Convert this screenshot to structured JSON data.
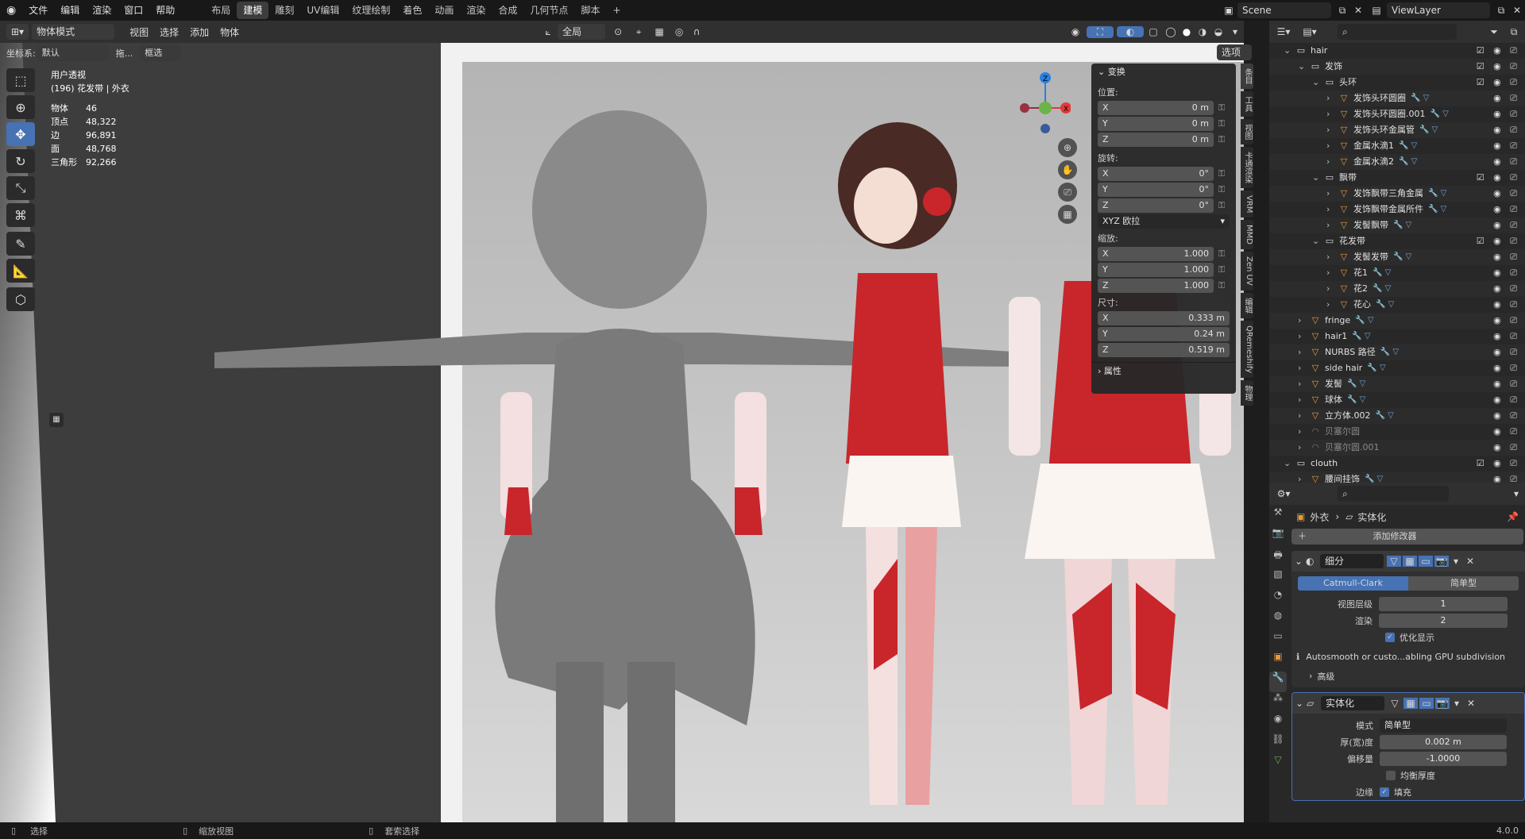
{
  "topbar": {
    "menus": [
      "文件",
      "编辑",
      "渲染",
      "窗口",
      "帮助"
    ],
    "workspaces": [
      "布局",
      "建模",
      "雕刻",
      "UV编辑",
      "纹理绘制",
      "着色",
      "动画",
      "渲染",
      "合成",
      "几何节点",
      "脚本"
    ],
    "active_workspace": "建模",
    "add_tab": "+",
    "scene": "Scene",
    "viewlayer": "ViewLayer"
  },
  "viewport_header": {
    "mode": "物体模式",
    "menus": [
      "视图",
      "选择",
      "添加",
      "物体"
    ],
    "transform_orientation": "全局",
    "options": "选项",
    "coord_label": "坐标系:",
    "coord_value": "默认",
    "drag_label": "拖...",
    "select_mode": "框选"
  },
  "stats": {
    "view": "用户透视",
    "object": "(196) 花发带 | 外衣",
    "rows": [
      {
        "k": "物体",
        "v": "46"
      },
      {
        "k": "顶点",
        "v": "48,322"
      },
      {
        "k": "边",
        "v": "96,891"
      },
      {
        "k": "面",
        "v": "48,768"
      },
      {
        "k": "三角形",
        "v": "92,266"
      }
    ]
  },
  "npanel": {
    "header": "变换",
    "location_label": "位置:",
    "location": [
      {
        "a": "X",
        "v": "0 m"
      },
      {
        "a": "Y",
        "v": "0 m"
      },
      {
        "a": "Z",
        "v": "0 m"
      }
    ],
    "rotation_label": "旋转:",
    "rotation": [
      {
        "a": "X",
        "v": "0°"
      },
      {
        "a": "Y",
        "v": "0°"
      },
      {
        "a": "Z",
        "v": "0°"
      }
    ],
    "rotation_mode": "XYZ 欧拉",
    "scale_label": "缩放:",
    "scale": [
      {
        "a": "X",
        "v": "1.000"
      },
      {
        "a": "Y",
        "v": "1.000"
      },
      {
        "a": "Z",
        "v": "1.000"
      }
    ],
    "dimensions_label": "尺寸:",
    "dimensions": [
      {
        "a": "X",
        "v": "0.333 m"
      },
      {
        "a": "Y",
        "v": "0.24 m"
      },
      {
        "a": "Z",
        "v": "0.519 m"
      }
    ],
    "properties": "属性",
    "tabs": [
      "条目",
      "工具",
      "视图",
      "卡通渲染",
      "VRM",
      "MMD",
      "Zen UV",
      "编辑",
      "QRemeshify",
      "物理"
    ]
  },
  "outliner": {
    "rows": [
      {
        "indent": 1,
        "label": "hair",
        "type": "coll"
      },
      {
        "indent": 2,
        "label": "发饰",
        "type": "coll"
      },
      {
        "indent": 3,
        "label": "头环",
        "type": "coll"
      },
      {
        "indent": 4,
        "label": "发饰头环圆圈",
        "type": "mesh"
      },
      {
        "indent": 4,
        "label": "发饰头环圆圈.001",
        "type": "mesh"
      },
      {
        "indent": 4,
        "label": "发饰头环金属管",
        "type": "mesh"
      },
      {
        "indent": 4,
        "label": "金属水滴1",
        "type": "mesh"
      },
      {
        "indent": 4,
        "label": "金属水滴2",
        "type": "mesh"
      },
      {
        "indent": 3,
        "label": "飘带",
        "type": "coll"
      },
      {
        "indent": 4,
        "label": "发饰飘带三角金属",
        "type": "mesh"
      },
      {
        "indent": 4,
        "label": "发饰飘带金属所件",
        "type": "mesh"
      },
      {
        "indent": 4,
        "label": "发髻飘带",
        "type": "mesh"
      },
      {
        "indent": 3,
        "label": "花发带",
        "type": "coll"
      },
      {
        "indent": 4,
        "label": "发髻发带",
        "type": "mesh"
      },
      {
        "indent": 4,
        "label": "花1",
        "type": "mesh"
      },
      {
        "indent": 4,
        "label": "花2",
        "type": "mesh"
      },
      {
        "indent": 4,
        "label": "花心",
        "type": "mesh"
      },
      {
        "indent": 2,
        "label": "fringe",
        "type": "mesh"
      },
      {
        "indent": 2,
        "label": "hair1",
        "type": "mesh"
      },
      {
        "indent": 2,
        "label": "NURBS 路径",
        "type": "mesh"
      },
      {
        "indent": 2,
        "label": "side hair",
        "type": "mesh"
      },
      {
        "indent": 2,
        "label": "发髻",
        "type": "mesh"
      },
      {
        "indent": 2,
        "label": "球体",
        "type": "mesh"
      },
      {
        "indent": 2,
        "label": "立方体.002",
        "type": "mesh"
      },
      {
        "indent": 2,
        "label": "贝塞尔圆",
        "type": "curve"
      },
      {
        "indent": 2,
        "label": "贝塞尔圆.001",
        "type": "curve"
      },
      {
        "indent": 1,
        "label": "clouth",
        "type": "coll"
      },
      {
        "indent": 2,
        "label": "腰间挂饰",
        "type": "mesh"
      }
    ]
  },
  "properties": {
    "breadcrumb_obj": "外衣",
    "breadcrumb_mod": "实体化",
    "add_modifier": "添加修改器",
    "mod1": {
      "name": "细分",
      "algo_a": "Catmull-Clark",
      "algo_b": "简单型",
      "viewport_label": "视图层级",
      "viewport_value": "1",
      "render_label": "渲染",
      "render_value": "2",
      "optimal": "优化显示",
      "warning": "Autosmooth or custo...abling GPU subdivision",
      "advanced": "高级"
    },
    "mod2": {
      "name": "实体化",
      "mode_label": "模式",
      "mode_value": "简单型",
      "thickness_label": "厚(宽)度",
      "thickness_value": "0.002 m",
      "offset_label": "偏移量",
      "offset_value": "-1.0000",
      "even": "均衡厚度",
      "rim_label": "边缘",
      "rim_fill": "填充"
    }
  },
  "statusbar": {
    "select": "选择",
    "zoom": "缩放视图",
    "lasso": "套索选择",
    "version": "4.0.0"
  },
  "colors": {
    "accent": "#4772b3",
    "mesh": "#e89a3c",
    "modifier": "#6ea6d8"
  }
}
